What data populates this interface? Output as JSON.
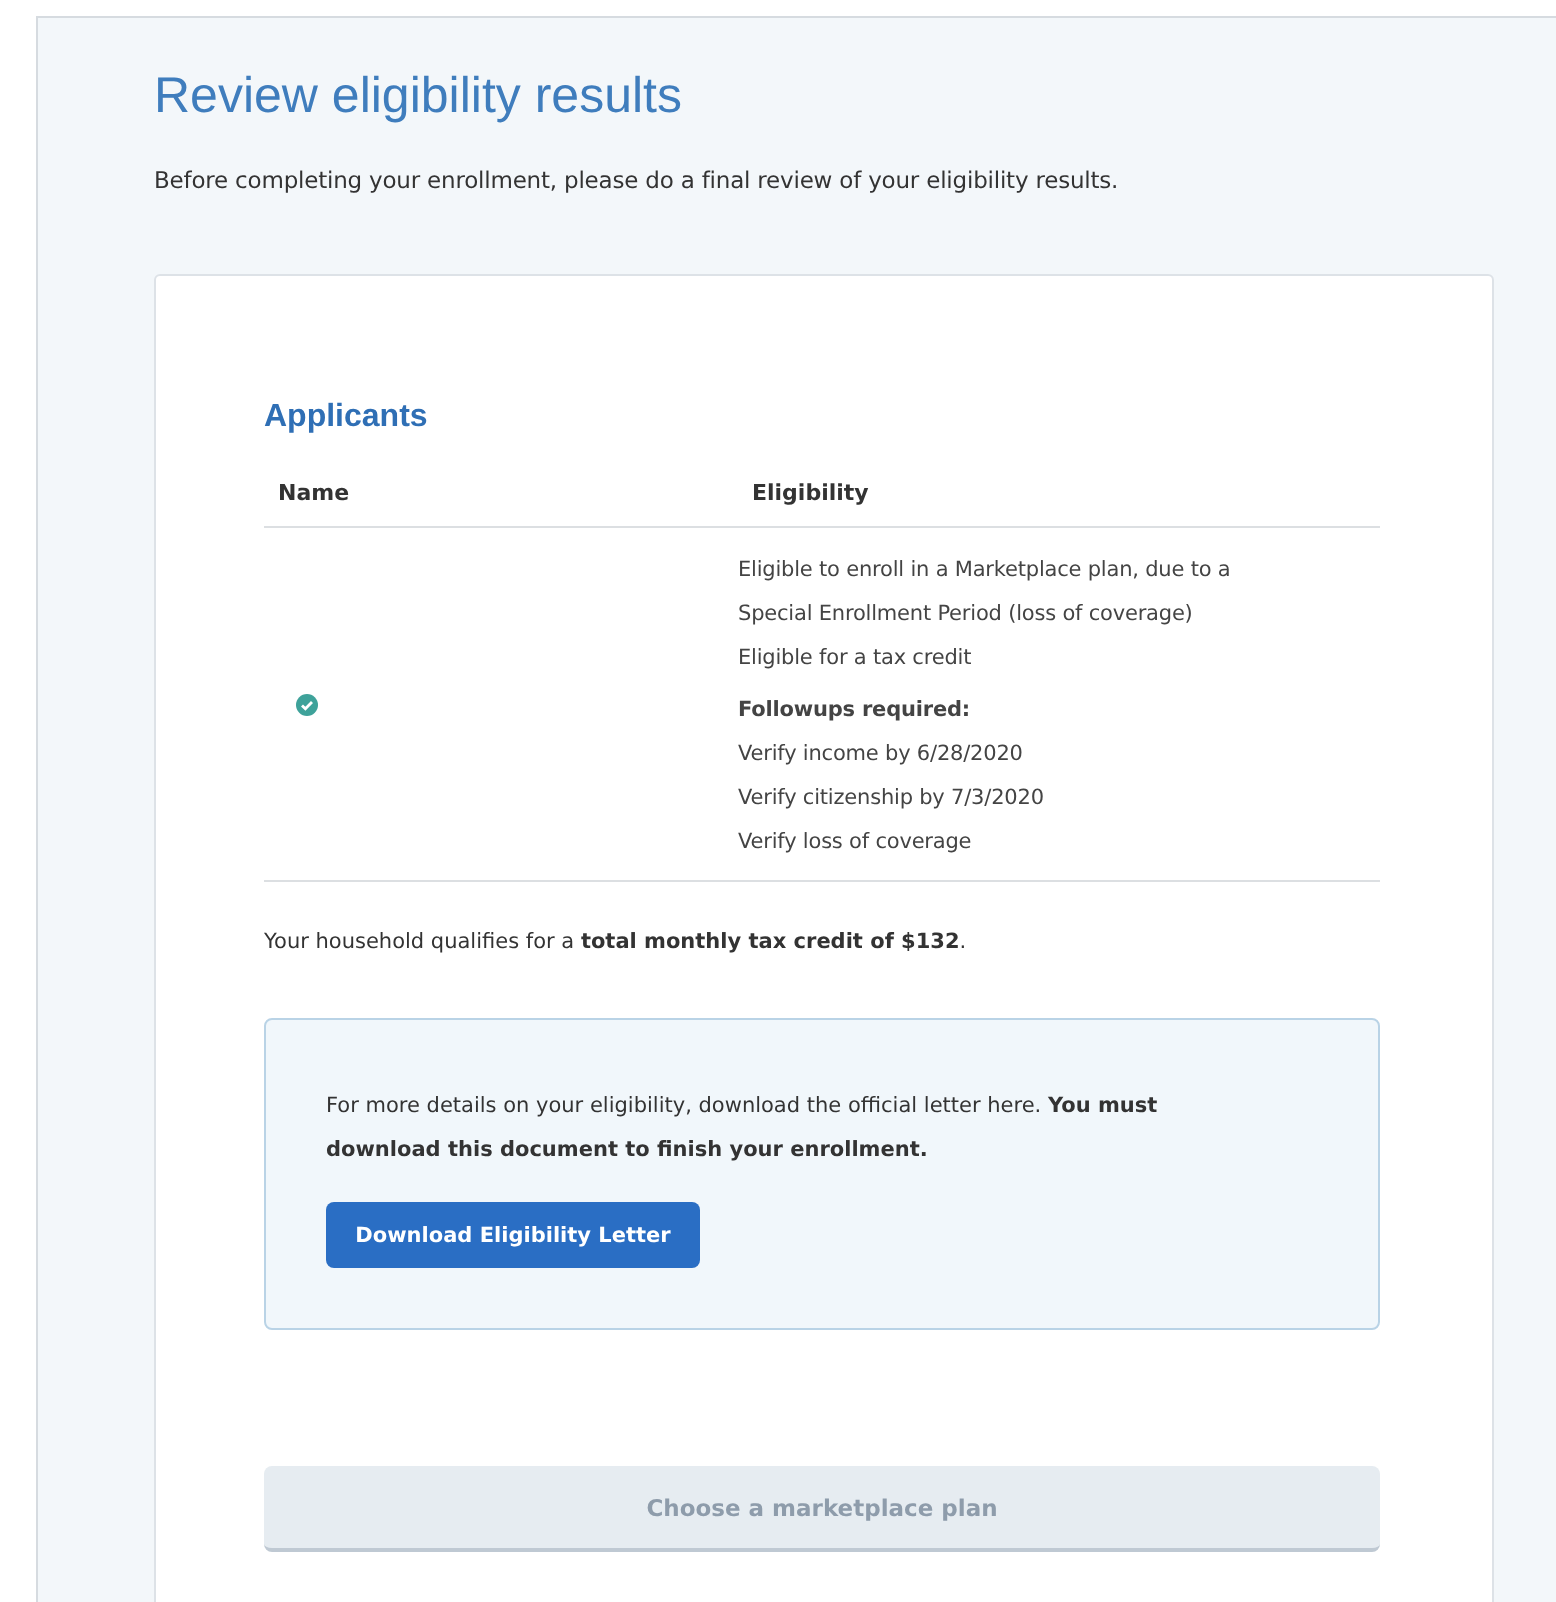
{
  "page": {
    "title": "Review eligibility results",
    "intro": "Before completing your enrollment, please do a final review of your eligibility results."
  },
  "applicants": {
    "heading": "Applicants",
    "columns": [
      "Name",
      "Eligibility"
    ],
    "rows": [
      {
        "eligible": true,
        "eligibility": [
          "Eligible to enroll in a Marketplace plan, due to a Special Enrollment Period (loss of coverage)",
          "Eligible for a tax credit"
        ],
        "followups_heading": "Followups required:",
        "followups": [
          "Verify income by 6/28/2020",
          "Verify citizenship by 7/3/2020",
          "Verify loss of coverage"
        ]
      }
    ]
  },
  "summary": "Your household qualifies for a **total monthly tax credit of $132**.",
  "letter_box": {
    "text": "For more details on your eligibility, download the official letter here. **You must download this document to finish your enrollment.**",
    "button": "Download Eligibility Letter"
  },
  "next_button": {
    "label": "Choose a marketplace plan",
    "disabled": true
  }
}
